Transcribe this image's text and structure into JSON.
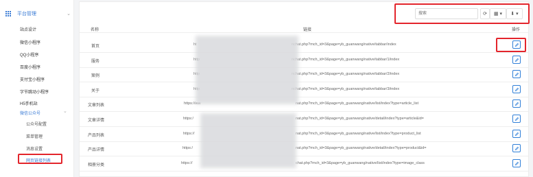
{
  "sidebar": {
    "section_title": "平台管理",
    "items": [
      {
        "label": "站点设计"
      },
      {
        "label": "微信小程序"
      },
      {
        "label": "QQ小程序"
      },
      {
        "label": "百度小程序"
      },
      {
        "label": "支付宝小程序"
      },
      {
        "label": "字节跳动小程序"
      },
      {
        "label": "H5手机站"
      },
      {
        "label": "微信公众号"
      }
    ],
    "sub_items": [
      {
        "label": "公众号配置"
      },
      {
        "label": "菜单管理"
      },
      {
        "label": "消息设置"
      },
      {
        "label": "网页链接列表"
      }
    ]
  },
  "toolbar": {
    "search_placeholder": "搜索",
    "refresh_glyph": "⟳",
    "columns_glyph": "▦ ▾",
    "export_glyph": "⬇ ▾"
  },
  "table": {
    "headers": {
      "name": "名称",
      "link": "链接",
      "ops": "操作"
    },
    "rows": [
      {
        "name": "首页",
        "prefix": "ht",
        "suffix": "nchat.php?mch_id=3&page=yb_guanwang/native/tabbar/index"
      },
      {
        "name": "服务",
        "prefix": "http",
        "suffix": "nchat.php?mch_id=3&page=yb_guanwang/native/tabbar/1/index"
      },
      {
        "name": "案例",
        "prefix": "http",
        "suffix": "nchat.php?mch_id=3&page=yb_guanwang/native/tabbar/2/index"
      },
      {
        "name": "关于",
        "prefix": "http",
        "suffix": "nchat.php?mch_id=3&page=yb_guanwang/native/tabbar/3/index"
      },
      {
        "name": "文章列表",
        "prefix": "https://ww",
        "suffix": "nat.php?mch_id=3&page=yb_guanwang/native/list/index?type=article_list"
      },
      {
        "name": "文章详情",
        "prefix": "https:/",
        "suffix": "nat.php?mch_id=3&page=yb_guanwang/native/detail/index?type=article&id="
      },
      {
        "name": "产品列表",
        "prefix": "https://",
        "suffix": "nat.php?mch_id=3&page=yb_guanwang/native/list/index?type=product_list"
      },
      {
        "name": "产品详情",
        "prefix": "https:/",
        "suffix": "nat.php?mch_id=3&page=yb_guanwang/native/detail/index?type=product&id="
      },
      {
        "name": "相册分类",
        "prefix": "https://",
        "suffix": "chat.php?mch_id=3&page=yb_guanwang/native/list/index?type=image_class"
      }
    ]
  },
  "colors": {
    "accent": "#3a7bd5",
    "highlight": "#e3242b"
  }
}
